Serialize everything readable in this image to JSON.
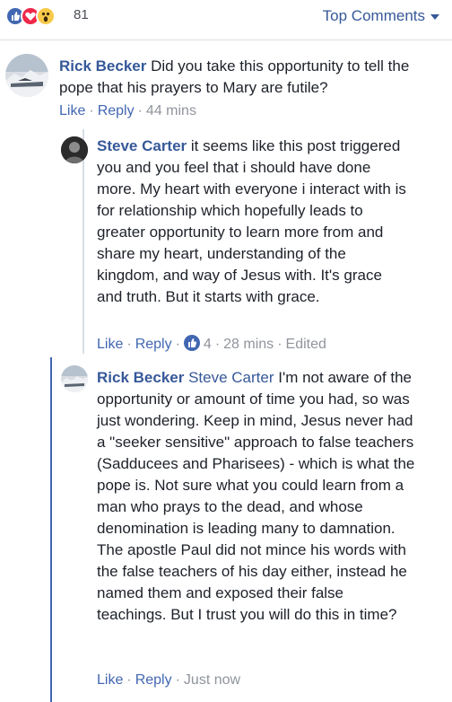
{
  "reactions": {
    "count": "81",
    "icons": [
      "like-icon",
      "love-icon",
      "wow-icon"
    ],
    "colors": {
      "like": "#4267b2",
      "love": "#f0284a",
      "wow": "#f7c94a"
    }
  },
  "sort": {
    "label": "Top Comments"
  },
  "comments": [
    {
      "author": "Rick Becker",
      "text": "Did you take this opportunity to tell the pope that his prayers to Mary are futile?",
      "like": "Like",
      "reply": "Reply",
      "time": "44 mins"
    },
    {
      "author": "Steve Carter",
      "text": "it seems like this post triggered you and you feel that i should have done more. My heart with everyone i interact with is for relationship which hopefully leads to greater opportunity to learn more from and share my heart, understanding of the kingdom, and way of Jesus with. It's grace and truth. But it starts with grace.",
      "like": "Like",
      "reply": "Reply",
      "likes_count": "4",
      "time": "28 mins",
      "edited": "Edited"
    },
    {
      "author": "Rick Becker",
      "mention": "Steve Carter",
      "text": "I'm not aware of the opportunity or amount of time you had, so was just wondering. Keep in mind, Jesus never had a \"seeker sensitive\" approach to false teachers (Sadducees and Pharisees) - which is what the pope is. Not sure what you could learn from a man who prays to the dead, and whose denomination is leading many to damnation. The apostle Paul did not mince his words with the false teachers of his day either, instead he named them and exposed their false teachings. But I trust you will do this in time?",
      "like": "Like",
      "reply": "Reply",
      "time": "Just now"
    }
  ]
}
